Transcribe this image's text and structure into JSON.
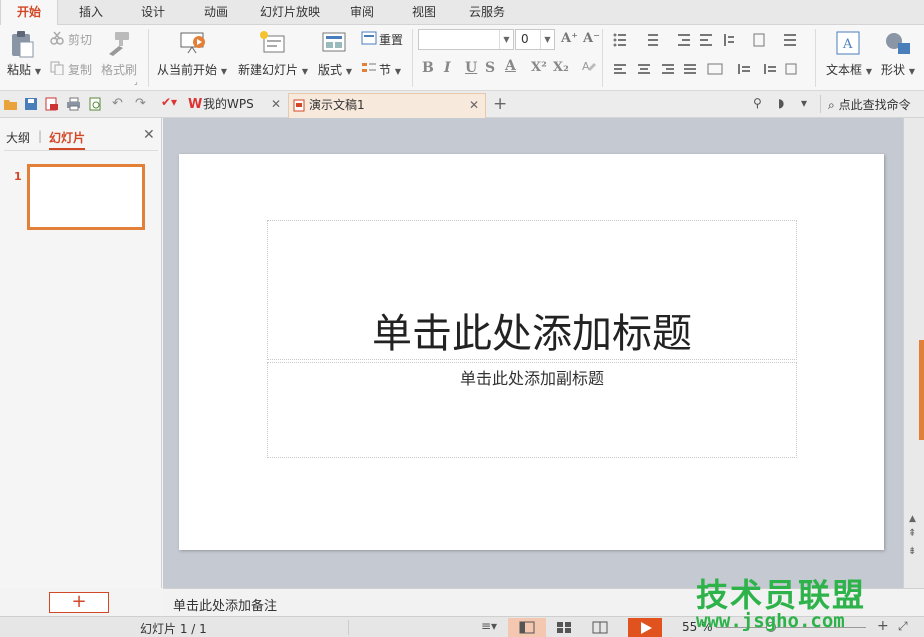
{
  "menu": {
    "tabs": [
      "开始",
      "插入",
      "设计",
      "动画",
      "幻灯片放映",
      "审阅",
      "视图",
      "云服务"
    ],
    "active_index": 0
  },
  "ribbon": {
    "paste": "粘贴",
    "cut": "剪切",
    "copy": "复制",
    "format_painter": "格式刷",
    "play_from_current": "从当前开始",
    "new_slide": "新建幻灯片",
    "layout": "版式",
    "reset": "重置",
    "section": "节",
    "font_size_value": "0",
    "textbox": "文本框",
    "shape": "形状",
    "bold": "B",
    "italic": "I",
    "underline": "U",
    "strike": "S",
    "font_color": "A",
    "superscript": "X²",
    "subscript": "X₂",
    "grow_font": "A⁺",
    "shrink_font": "A⁻"
  },
  "quickbar": {
    "tab_mywps": "我的WPS",
    "tab_doc": "演示文稿1",
    "search": "点此查找命令",
    "add_tab": "+"
  },
  "leftpanel": {
    "tab_outline": "大纲",
    "tab_slides": "幻灯片",
    "divider": "|",
    "slide_number": "1",
    "add_button": "+"
  },
  "slide": {
    "title_placeholder": "单击此处添加标题",
    "subtitle_placeholder": "单击此处添加副标题"
  },
  "notes": {
    "placeholder": "单击此处添加备注"
  },
  "status": {
    "slide_counter": "幻灯片 1 / 1",
    "zoom": "55 %"
  },
  "watermark": {
    "text": "技术员联盟",
    "url": "www.jsgho.com"
  },
  "colors": {
    "accent": "#d24726",
    "thumb_border": "#e2803a",
    "watermark": "#2db34a"
  }
}
